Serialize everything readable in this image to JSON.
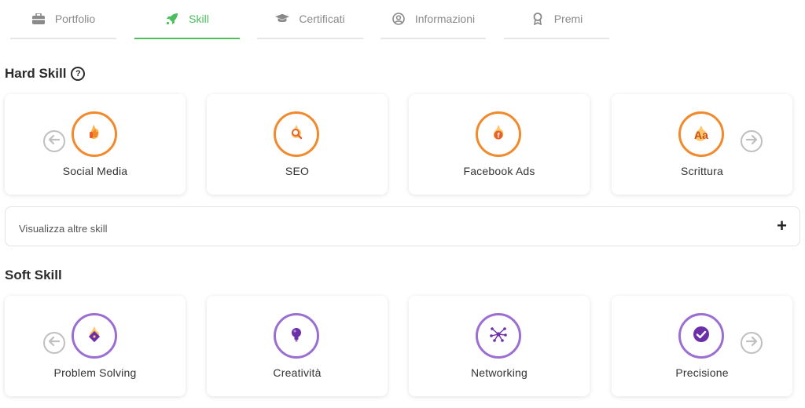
{
  "tabs": [
    {
      "label": "Portfolio",
      "icon": "briefcase-icon"
    },
    {
      "label": "Skill",
      "icon": "rocket-icon",
      "active": true
    },
    {
      "label": "Certificati",
      "icon": "graduation-cap-icon"
    },
    {
      "label": "Informazioni",
      "icon": "user-circle-icon"
    },
    {
      "label": "Premi",
      "icon": "award-icon"
    }
  ],
  "hard_skill": {
    "title": "Hard Skill",
    "help_symbol": "?",
    "items": [
      {
        "label": "Social Media",
        "icon": "thumbs-up-icon"
      },
      {
        "label": "SEO",
        "icon": "magnifier-icon"
      },
      {
        "label": "Facebook Ads",
        "icon": "facebook-icon"
      },
      {
        "label": "Scrittura",
        "icon": "text-aa-icon",
        "glyph": "Aa"
      }
    ]
  },
  "more_skills": {
    "label": "Visualizza altre skill",
    "action": "+"
  },
  "soft_skill": {
    "title": "Soft Skill",
    "items": [
      {
        "label": "Problem Solving",
        "icon": "puzzle-icon"
      },
      {
        "label": "Creatività",
        "icon": "lightbulb-icon"
      },
      {
        "label": "Networking",
        "icon": "network-icon"
      },
      {
        "label": "Precisione",
        "icon": "check-circle-icon"
      }
    ]
  },
  "colors": {
    "accent_green": "#4cbf5c",
    "hard_ring": "#f08a2c",
    "soft_ring": "#9b6fd1",
    "soft_icon": "#6b2fa8"
  }
}
